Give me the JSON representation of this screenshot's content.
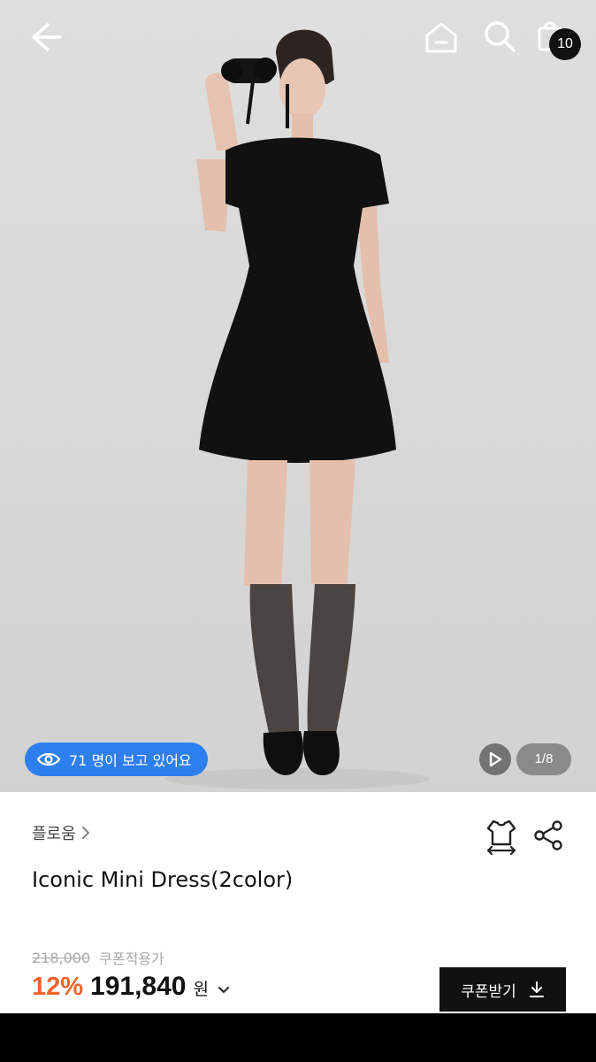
{
  "header": {
    "back_icon": "arrow-left-icon",
    "home_icon": "home-icon",
    "search_icon": "search-icon",
    "bag_icon": "shopping-bag-icon",
    "cart_count": "10"
  },
  "gallery": {
    "viewers_text": "71 명이 보고 있어요",
    "viewers_icon": "eye-icon",
    "play_icon": "play-icon",
    "page_indicator": "1/8",
    "accent_color": "#2d7ff0"
  },
  "product": {
    "brand": "플로움",
    "title": "Iconic Mini Dress(2color)",
    "original_price": "218,000",
    "coupon_price_label": "쿠폰적용가",
    "discount": "12%",
    "price": "191,840",
    "currency": "원",
    "coupon_button": "쿠폰받기",
    "discount_color": "#f0642a"
  }
}
